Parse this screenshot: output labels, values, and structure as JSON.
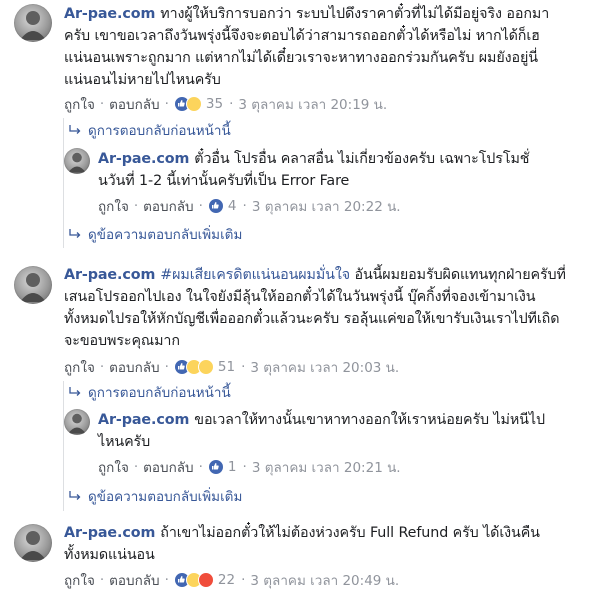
{
  "comments": [
    {
      "author": "Ar-pae.com",
      "text": "ทางผู้ให้บริการบอกว่า ระบบไปดึงราคาตั๋วที่ไม่ได้มีอยู่จริง ออกมาครับ เขาขอเวลาถึงวันพรุ่งนี้จึงจะตอบได้ว่าสามารถออกตั๋วได้หรือไม่ หากได้ก็เฮแน่นอนเพราะถูกมาก แต่หากไม่ได้เดี๋ยวเราจะหาทางออกร่วมกันครับ ผมยังอยู่นี่แน่นอนไม่หายไปไหนครับ",
      "like": "ถูกใจ",
      "reply": "ตอบกลับ",
      "reactions": [
        "like",
        "haha"
      ],
      "count": "35",
      "time": "3 ตุลาคม เวลา 20:19 น.",
      "prev_replies": "ดูการตอบกลับก่อนหน้านี้",
      "sub": {
        "author": "Ar-pae.com",
        "text": "ตั๋วอื่น โปรอื่น คลาสอื่น ไม่เกี่ยวข้องครับ เฉพาะโปรโมชั่นวันที่ 1-2 นี้เท่านั้นครับที่เป็น Error Fare",
        "like": "ถูกใจ",
        "reply": "ตอบกลับ",
        "reactions": [
          "like"
        ],
        "count": "4",
        "time": "3 ตุลาคม เวลา 20:22 น."
      },
      "more_replies": "ดูข้อความตอบกลับเพิ่มเติม"
    },
    {
      "author": "Ar-pae.com",
      "hashtag": "#ผมเสียเครดิตแน่นอนผมมั่นใจ",
      "text": "อันนี้ผมยอมรับผิดแทนทุกฝ่ายครับที่เสนอโปรออกไปเอง ในใจยังมีลุ้นให้ออกตั๋วได้ในวันพรุ่งนี้ บุ๊คกิ้งที่จองเข้ามาเงินทั้งหมดไปรอให้หักบัญชีเพื่อออกตั๋วแล้วนะครับ รอลุ้นแค่ขอให้เขารับเงินเราไปทีเถิด จะขอบพระคุณมาก",
      "like": "ถูกใจ",
      "reply": "ตอบกลับ",
      "reactions": [
        "like",
        "haha",
        "wow"
      ],
      "count": "51",
      "time": "3 ตุลาคม เวลา 20:03 น.",
      "prev_replies": "ดูการตอบกลับก่อนหน้านี้",
      "sub": {
        "author": "Ar-pae.com",
        "text": "ขอเวลาให้ทางนั้นเขาหาทางออกให้เราหน่อยครับ ไม่หนีไปไหนครับ",
        "like": "ถูกใจ",
        "reply": "ตอบกลับ",
        "reactions": [
          "like"
        ],
        "count": "1",
        "time": "3 ตุลาคม เวลา 20:21 น."
      },
      "more_replies": "ดูข้อความตอบกลับเพิ่มเติม"
    },
    {
      "author": "Ar-pae.com",
      "text": "ถ้าเขาไม่ออกตั๋วให้ไม่ต้องห่วงครับ Full Refund ครับ ได้เงินคืนทั้งหมดแน่นอน",
      "like": "ถูกใจ",
      "reply": "ตอบกลับ",
      "reactions": [
        "like",
        "haha",
        "angry"
      ],
      "count": "22",
      "time": "3 ตุลาคม เวลา 20:49 น."
    }
  ],
  "colors": {
    "link": "#385898",
    "meta": "#90949c",
    "like": "#4267b2"
  }
}
